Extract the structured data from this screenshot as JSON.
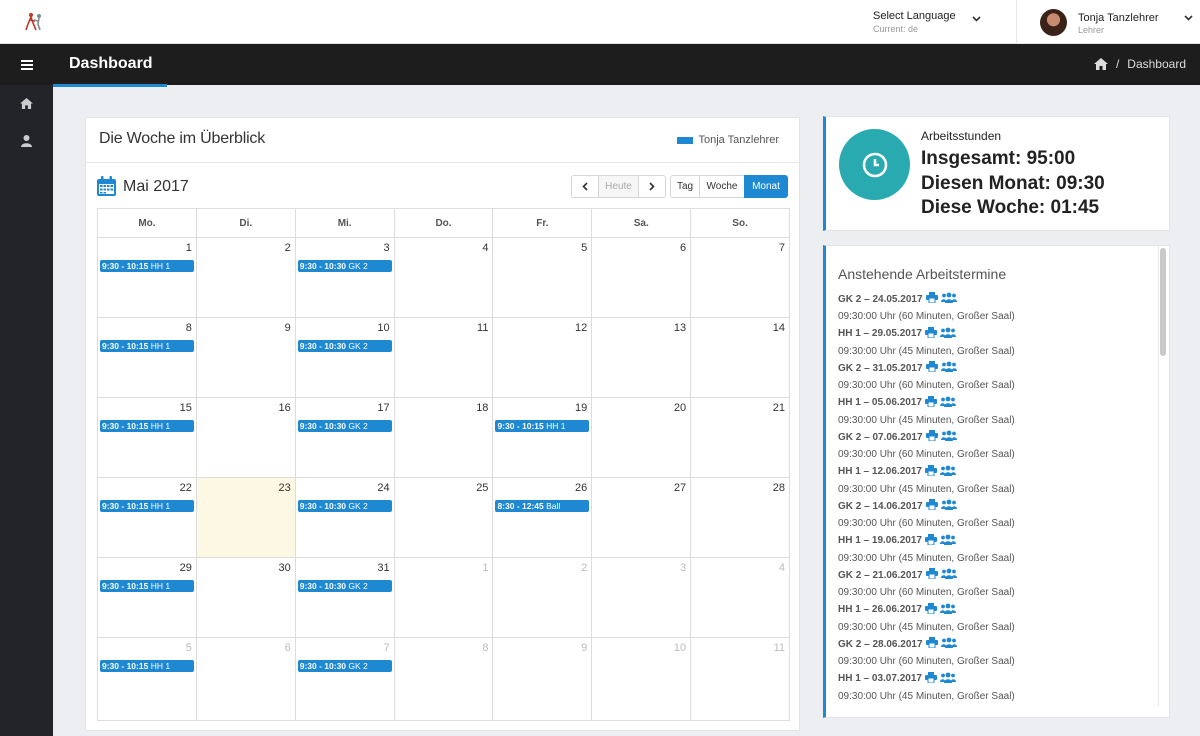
{
  "topbar": {
    "language_label": "Select Language",
    "language_current": "Current: de",
    "user_name": "Tonja Tanzlehrer",
    "user_role": "Lehrer"
  },
  "header": {
    "title": "Dashboard",
    "breadcrumb": "Dashboard"
  },
  "sidebar": {
    "items": [
      {
        "icon": "home-icon"
      },
      {
        "icon": "user-icon"
      }
    ]
  },
  "calendar_panel": {
    "title": "Die Woche im Überblick",
    "legend": "Tonja Tanzlehrer",
    "month_title": "Mai 2017",
    "buttons": {
      "prev": "‹",
      "today": "Heute",
      "next": "›",
      "day": "Tag",
      "week": "Woche",
      "month": "Monat"
    },
    "active_view": "Monat",
    "weekdays": [
      "Mo.",
      "Di.",
      "Mi.",
      "Do.",
      "Fr.",
      "Sa.",
      "So."
    ],
    "weeks": [
      [
        {
          "n": "1",
          "e": {
            "t": "9:30 - 10:15",
            "c": "HH 1"
          }
        },
        {
          "n": "2"
        },
        {
          "n": "3",
          "e": {
            "t": "9:30 - 10:30",
            "c": "GK 2"
          }
        },
        {
          "n": "4"
        },
        {
          "n": "5"
        },
        {
          "n": "6"
        },
        {
          "n": "7"
        }
      ],
      [
        {
          "n": "8",
          "e": {
            "t": "9:30 - 10:15",
            "c": "HH 1"
          }
        },
        {
          "n": "9"
        },
        {
          "n": "10",
          "e": {
            "t": "9:30 - 10:30",
            "c": "GK 2"
          }
        },
        {
          "n": "11"
        },
        {
          "n": "12"
        },
        {
          "n": "13"
        },
        {
          "n": "14"
        }
      ],
      [
        {
          "n": "15",
          "e": {
            "t": "9:30 - 10:15",
            "c": "HH 1"
          }
        },
        {
          "n": "16"
        },
        {
          "n": "17",
          "e": {
            "t": "9:30 - 10:30",
            "c": "GK 2"
          }
        },
        {
          "n": "18"
        },
        {
          "n": "19",
          "e": {
            "t": "9:30 - 10:15",
            "c": "HH 1"
          }
        },
        {
          "n": "20"
        },
        {
          "n": "21"
        }
      ],
      [
        {
          "n": "22",
          "e": {
            "t": "9:30 - 10:15",
            "c": "HH 1"
          }
        },
        {
          "n": "23",
          "today": true
        },
        {
          "n": "24",
          "e": {
            "t": "9:30 - 10:30",
            "c": "GK 2"
          }
        },
        {
          "n": "25"
        },
        {
          "n": "26",
          "e": {
            "t": "8:30 - 12:45",
            "c": "Ball"
          }
        },
        {
          "n": "27"
        },
        {
          "n": "28"
        }
      ],
      [
        {
          "n": "29",
          "e": {
            "t": "9:30 - 10:15",
            "c": "HH 1"
          }
        },
        {
          "n": "30"
        },
        {
          "n": "31",
          "e": {
            "t": "9:30 - 10:30",
            "c": "GK 2"
          }
        },
        {
          "n": "1",
          "other": true
        },
        {
          "n": "2",
          "other": true
        },
        {
          "n": "3",
          "other": true
        },
        {
          "n": "4",
          "other": true
        }
      ],
      [
        {
          "n": "5",
          "other": true,
          "e": {
            "t": "9:30 - 10:15",
            "c": "HH 1"
          }
        },
        {
          "n": "6",
          "other": true
        },
        {
          "n": "7",
          "other": true,
          "e": {
            "t": "9:30 - 10:30",
            "c": "GK 2"
          }
        },
        {
          "n": "8",
          "other": true
        },
        {
          "n": "9",
          "other": true
        },
        {
          "n": "10",
          "other": true
        },
        {
          "n": "11",
          "other": true
        }
      ]
    ]
  },
  "hours": {
    "label": "Arbeitsstunden",
    "total": "Insgesamt: 95:00",
    "month": "Diesen Monat: 09:30",
    "week": "Diese Woche: 01:45"
  },
  "appointments": {
    "title": "Anstehende Arbeitstermine",
    "items": [
      {
        "head": "GK 2 – 24.05.2017",
        "detail": "09:30:00 Uhr (60 Minuten, Großer Saal)"
      },
      {
        "head": "HH 1 – 29.05.2017",
        "detail": "09:30:00 Uhr (45 Minuten, Großer Saal)"
      },
      {
        "head": "GK 2 – 31.05.2017",
        "detail": "09:30:00 Uhr (60 Minuten, Großer Saal)"
      },
      {
        "head": "HH 1 – 05.06.2017",
        "detail": "09:30:00 Uhr (45 Minuten, Großer Saal)"
      },
      {
        "head": "GK 2 – 07.06.2017",
        "detail": "09:30:00 Uhr (60 Minuten, Großer Saal)"
      },
      {
        "head": "HH 1 – 12.06.2017",
        "detail": "09:30:00 Uhr (45 Minuten, Großer Saal)"
      },
      {
        "head": "GK 2 – 14.06.2017",
        "detail": "09:30:00 Uhr (60 Minuten, Großer Saal)"
      },
      {
        "head": "HH 1 – 19.06.2017",
        "detail": "09:30:00 Uhr (45 Minuten, Großer Saal)"
      },
      {
        "head": "GK 2 – 21.06.2017",
        "detail": "09:30:00 Uhr (60 Minuten, Großer Saal)"
      },
      {
        "head": "HH 1 – 26.06.2017",
        "detail": "09:30:00 Uhr (45 Minuten, Großer Saal)"
      },
      {
        "head": "GK 2 – 28.06.2017",
        "detail": "09:30:00 Uhr (60 Minuten, Großer Saal)"
      },
      {
        "head": "HH 1 – 03.07.2017",
        "detail": "09:30:00 Uhr (45 Minuten, Großer Saal)"
      }
    ]
  },
  "colors": {
    "accent": "#1e88d2",
    "clock": "#28aab0",
    "today": "#fcf8e3"
  }
}
